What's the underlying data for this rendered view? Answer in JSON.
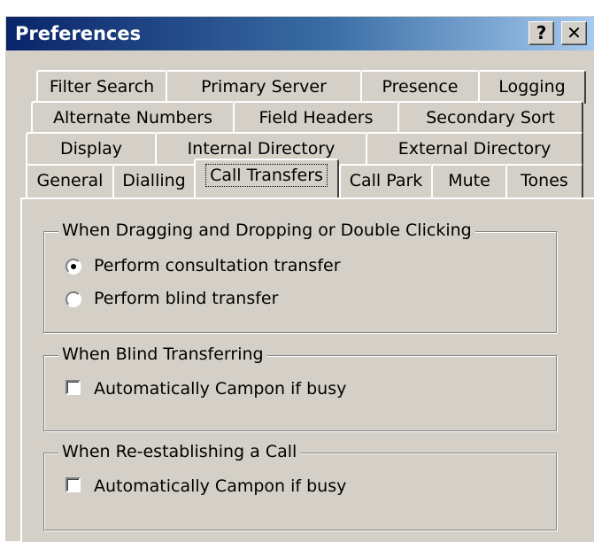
{
  "window": {
    "title": "Preferences",
    "help_label": "?",
    "close_label": "✕"
  },
  "tabs": {
    "row1": [
      "Filter Search",
      "Primary Server",
      "Presence",
      "Logging"
    ],
    "row2": [
      "Alternate Numbers",
      "Field Headers",
      "Secondary Sort"
    ],
    "row3": [
      "Display",
      "Internal Directory",
      "External Directory"
    ],
    "row4": [
      "General",
      "Dialling",
      "Call Transfers",
      "Call Park",
      "Mute",
      "Tones"
    ],
    "active": "Call Transfers"
  },
  "drag_drop_group": {
    "legend": "When Dragging and Dropping or Double Clicking",
    "options": [
      {
        "label": "Perform consultation transfer",
        "selected": true
      },
      {
        "label": "Perform blind transfer",
        "selected": false
      }
    ]
  },
  "blind_group": {
    "legend": "When Blind Transferring",
    "checkbox_label": "Automatically Campon if busy",
    "checked": false
  },
  "reestablish_group": {
    "legend": "When Re-establishing a Call",
    "checkbox_label": "Automatically Campon if busy",
    "checked": false
  }
}
